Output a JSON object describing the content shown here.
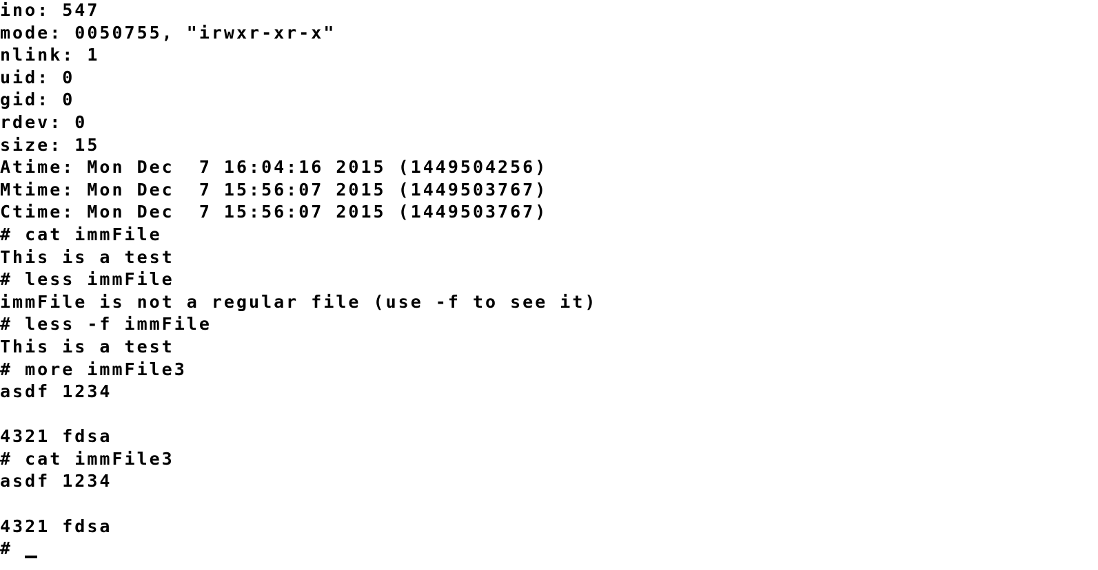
{
  "terminal": {
    "lines": [
      "ino: 547",
      "mode: 0050755, \"irwxr-xr-x\"",
      "nlink: 1",
      "uid: 0",
      "gid: 0",
      "rdev: 0",
      "size: 15",
      "Atime: Mon Dec  7 16:04:16 2015 (1449504256)",
      "Mtime: Mon Dec  7 15:56:07 2015 (1449503767)",
      "Ctime: Mon Dec  7 15:56:07 2015 (1449503767)",
      "# cat immFile",
      "This is a test",
      "# less immFile",
      "immFile is not a regular file (use -f to see it)",
      "# less -f immFile",
      "This is a test",
      "# more immFile3",
      "asdf 1234",
      "",
      "4321 fdsa",
      "# cat immFile3",
      "asdf 1234",
      "",
      "4321 fdsa"
    ],
    "prompt": "# "
  },
  "colors": {
    "background": "#ffffff",
    "foreground": "#000000"
  }
}
